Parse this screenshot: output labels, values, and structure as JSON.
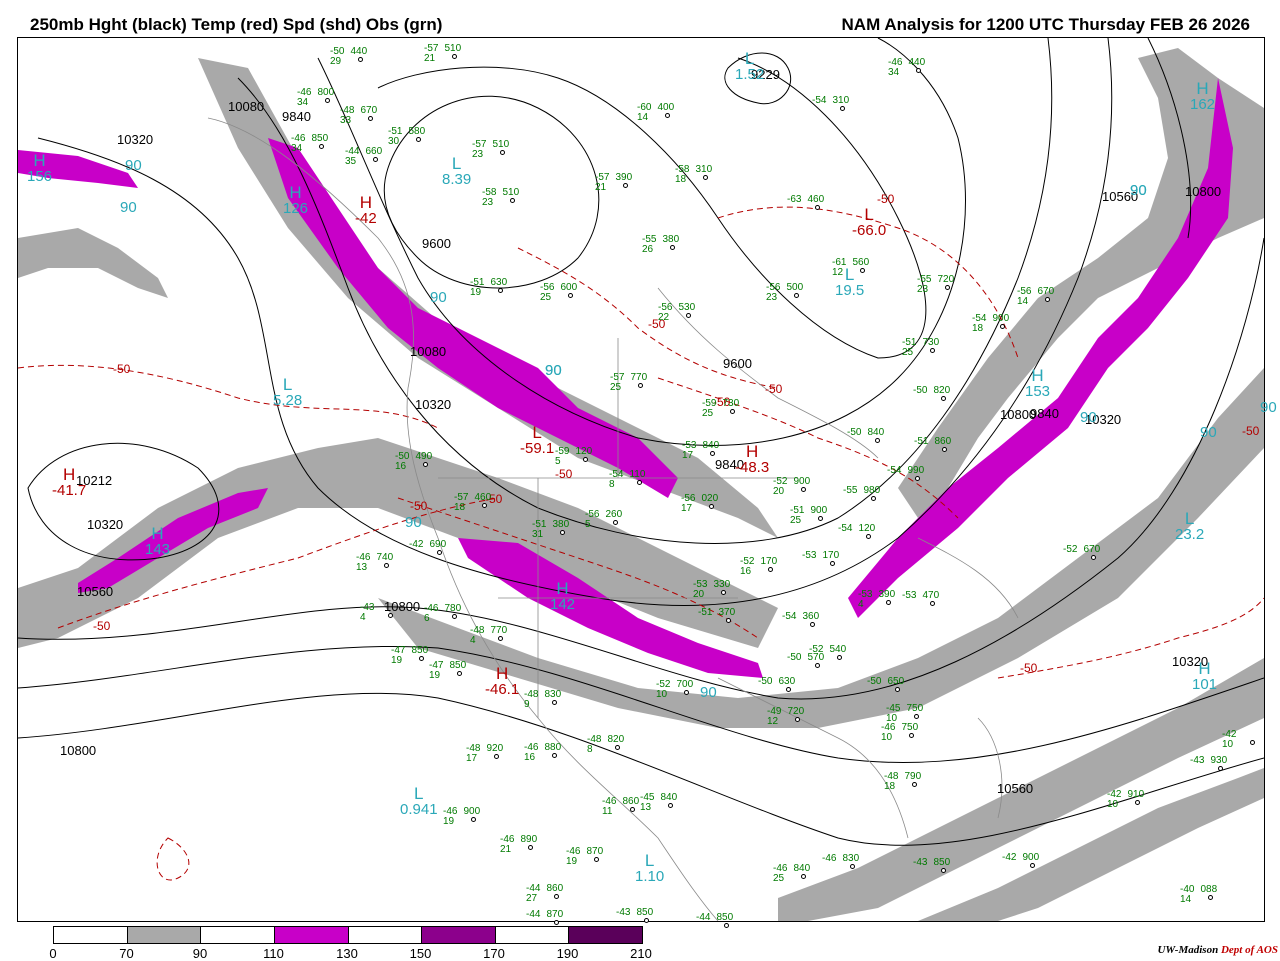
{
  "header": {
    "title_left": "250mb Hght (black) Temp (red) Spd (shd) Obs (grn)",
    "title_right": "NAM Analysis for 1200 UTC Thursday  FEB 26 2026"
  },
  "colors": {
    "height_contour": "#000000",
    "temperature_contour": "#b30000",
    "speed_label": "#2aa8b8",
    "obs": "#007a00",
    "shade_70_90": "#a9a9a9",
    "shade_110_130": "#c800c8",
    "shade_150_170": "#8c008c",
    "shade_190_210": "#5a005a"
  },
  "colorbar": {
    "ticks": [
      "0",
      "70",
      "90",
      "110",
      "130",
      "150",
      "170",
      "190",
      "210"
    ],
    "segment_colors": [
      "#ffffff",
      "#a9a9a9",
      "#ffffff",
      "#c800c8",
      "#ffffff",
      "#8c008c",
      "#ffffff",
      "#5a005a"
    ]
  },
  "height_labels": [
    "10320",
    "10080",
    "9840",
    "9600",
    "10080",
    "9840",
    "10320",
    "10212",
    "10320",
    "10560",
    "10800",
    "10800",
    "9600",
    "9840",
    "10320",
    "10560",
    "10320",
    "10560",
    "10800",
    "10800",
    "9229"
  ],
  "speed_labels": [
    "90",
    "90",
    "90",
    "90",
    "90",
    "90",
    "90",
    "90",
    "90",
    "90",
    "90",
    "90"
  ],
  "systems": [
    {
      "letter": "H",
      "value": "126",
      "kind": "cyan"
    },
    {
      "letter": "L",
      "value": "8.39",
      "kind": "cyan"
    },
    {
      "letter": "L",
      "value": "5.28",
      "kind": "cyan"
    },
    {
      "letter": "H",
      "value": "143",
      "kind": "cyan"
    },
    {
      "letter": "H",
      "value": "142",
      "kind": "cyan"
    },
    {
      "letter": "L",
      "value": "0.941",
      "kind": "cyan"
    },
    {
      "letter": "L",
      "value": "1.10",
      "kind": "cyan"
    },
    {
      "letter": "L",
      "value": "19.5",
      "kind": "cyan"
    },
    {
      "letter": "H",
      "value": "153",
      "kind": "cyan"
    },
    {
      "letter": "L",
      "value": "23.2",
      "kind": "cyan"
    },
    {
      "letter": "H",
      "value": "101",
      "kind": "cyan"
    },
    {
      "letter": "H",
      "value": "162",
      "kind": "cyan"
    },
    {
      "letter": "L",
      "value": "1.52",
      "kind": "cyan"
    },
    {
      "letter": "H",
      "value": "156",
      "kind": "cyan"
    },
    {
      "letter": "H",
      "value": "-42",
      "kind": "red"
    },
    {
      "letter": "H",
      "value": "-41.7",
      "kind": "red"
    },
    {
      "letter": "L",
      "value": "-59.1",
      "kind": "red"
    },
    {
      "letter": "H",
      "value": "-46.1",
      "kind": "red"
    },
    {
      "letter": "L",
      "value": "-66.0",
      "kind": "red"
    },
    {
      "letter": "H",
      "value": "-48.3",
      "kind": "red"
    }
  ],
  "temp_labels": [
    "-50",
    "-50",
    "-50",
    "-50",
    "-50",
    "-50",
    "-50",
    "-50",
    "-50",
    "-50",
    "-50"
  ],
  "observations": [
    {
      "t": "-50",
      "h": "440",
      "d": "29"
    },
    {
      "t": "-57",
      "h": "510",
      "d": "21"
    },
    {
      "t": "-46",
      "h": "800",
      "d": "34"
    },
    {
      "t": "-48",
      "h": "670",
      "d": "33"
    },
    {
      "t": "-51",
      "h": "580",
      "d": "30"
    },
    {
      "t": "-46",
      "h": "850",
      "d": "34"
    },
    {
      "t": "-44",
      "h": "660",
      "d": "35"
    },
    {
      "t": "-57",
      "h": "510",
      "d": "23"
    },
    {
      "t": "-57",
      "h": "390",
      "d": "21"
    },
    {
      "t": "-60",
      "h": "400",
      "d": "14"
    },
    {
      "t": "-58",
      "h": "310",
      "d": "18"
    },
    {
      "t": "-54",
      "h": "310",
      "d": ""
    },
    {
      "t": "-46",
      "h": "440",
      "d": "34"
    },
    {
      "t": "-63",
      "h": "460",
      "d": ""
    },
    {
      "t": "-55",
      "h": "380",
      "d": "26"
    },
    {
      "t": "-58",
      "h": "510",
      "d": "23"
    },
    {
      "t": "-51",
      "h": "630",
      "d": "19"
    },
    {
      "t": "-56",
      "h": "600",
      "d": "25"
    },
    {
      "t": "-56",
      "h": "530",
      "d": "22"
    },
    {
      "t": "-56",
      "h": "500",
      "d": "23"
    },
    {
      "t": "-61",
      "h": "560",
      "d": "12"
    },
    {
      "t": "-55",
      "h": "720",
      "d": "23"
    },
    {
      "t": "-56",
      "h": "670",
      "d": "14"
    },
    {
      "t": "-54",
      "h": "900",
      "d": "18"
    },
    {
      "t": "-51",
      "h": "730",
      "d": "25"
    },
    {
      "t": "-57",
      "h": "770",
      "d": "25"
    },
    {
      "t": "-50",
      "h": "820",
      "d": ""
    },
    {
      "t": "-59",
      "h": "730",
      "d": "25"
    },
    {
      "t": "-50",
      "h": "840",
      "d": ""
    },
    {
      "t": "-53",
      "h": "840",
      "d": "17"
    },
    {
      "t": "-51",
      "h": "860",
      "d": ""
    },
    {
      "t": "-50",
      "h": "490",
      "d": "16"
    },
    {
      "t": "-57",
      "h": "460",
      "d": "18"
    },
    {
      "t": "-59",
      "h": "120",
      "d": "5"
    },
    {
      "t": "-54",
      "h": "110",
      "d": "8"
    },
    {
      "t": "-56",
      "h": "020",
      "d": "17"
    },
    {
      "t": "-52",
      "h": "900",
      "d": "20"
    },
    {
      "t": "-55",
      "h": "980",
      "d": ""
    },
    {
      "t": "-54",
      "h": "990",
      "d": ""
    },
    {
      "t": "-51",
      "h": "900",
      "d": "25"
    },
    {
      "t": "-54",
      "h": "120",
      "d": ""
    },
    {
      "t": "-51",
      "h": "380",
      "d": "31"
    },
    {
      "t": "-56",
      "h": "260",
      "d": "5"
    },
    {
      "t": "-46",
      "h": "740",
      "d": "13"
    },
    {
      "t": "-42",
      "h": "690",
      "d": ""
    },
    {
      "t": "-52",
      "h": "170",
      "d": "16"
    },
    {
      "t": "-53",
      "h": "170",
      "d": ""
    },
    {
      "t": "-52",
      "h": "670",
      "d": ""
    },
    {
      "t": "-43",
      "h": "",
      "d": "4"
    },
    {
      "t": "-46",
      "h": "780",
      "d": "6"
    },
    {
      "t": "-48",
      "h": "770",
      "d": "4"
    },
    {
      "t": "-53",
      "h": "330",
      "d": "20"
    },
    {
      "t": "-51",
      "h": "370",
      "d": ""
    },
    {
      "t": "-54",
      "h": "360",
      "d": ""
    },
    {
      "t": "-53",
      "h": "390",
      "d": "4"
    },
    {
      "t": "-53",
      "h": "470",
      "d": ""
    },
    {
      "t": "-47",
      "h": "850",
      "d": "19"
    },
    {
      "t": "-47",
      "h": "850",
      "d": "19"
    },
    {
      "t": "-48",
      "h": "830",
      "d": "9"
    },
    {
      "t": "-50",
      "h": "570",
      "d": ""
    },
    {
      "t": "-52",
      "h": "540",
      "d": ""
    },
    {
      "t": "-50",
      "h": "650",
      "d": ""
    },
    {
      "t": "-52",
      "h": "700",
      "d": "10"
    },
    {
      "t": "-50",
      "h": "630",
      "d": ""
    },
    {
      "t": "-49",
      "h": "720",
      "d": "12"
    },
    {
      "t": "-45",
      "h": "750",
      "d": "10"
    },
    {
      "t": "-46",
      "h": "750",
      "d": "10"
    },
    {
      "t": "-48",
      "h": "920",
      "d": "17"
    },
    {
      "t": "-46",
      "h": "880",
      "d": "16"
    },
    {
      "t": "-48",
      "h": "820",
      "d": "8"
    },
    {
      "t": "-48",
      "h": "790",
      "d": "18"
    },
    {
      "t": "-42",
      "h": "",
      "d": "10"
    },
    {
      "t": "-43",
      "h": "930",
      "d": ""
    },
    {
      "t": "-42",
      "h": "910",
      "d": "10"
    },
    {
      "t": "-46",
      "h": "860",
      "d": "11"
    },
    {
      "t": "-45",
      "h": "840",
      "d": "13"
    },
    {
      "t": "-46",
      "h": "900",
      "d": "19"
    },
    {
      "t": "-46",
      "h": "890",
      "d": "21"
    },
    {
      "t": "-46",
      "h": "870",
      "d": "19"
    },
    {
      "t": "-44",
      "h": "860",
      "d": "27"
    },
    {
      "t": "-44",
      "h": "870",
      "d": ""
    },
    {
      "t": "-43",
      "h": "850",
      "d": ""
    },
    {
      "t": "-44",
      "h": "850",
      "d": ""
    },
    {
      "t": "-46",
      "h": "840",
      "d": "25"
    },
    {
      "t": "-46",
      "h": "830",
      "d": ""
    },
    {
      "t": "-43",
      "h": "850",
      "d": ""
    },
    {
      "t": "-42",
      "h": "900",
      "d": ""
    },
    {
      "t": "-40",
      "h": "088",
      "d": "14"
    }
  ],
  "credit": {
    "institution": "UW-Madison",
    "dept": "Dept of AOS"
  }
}
